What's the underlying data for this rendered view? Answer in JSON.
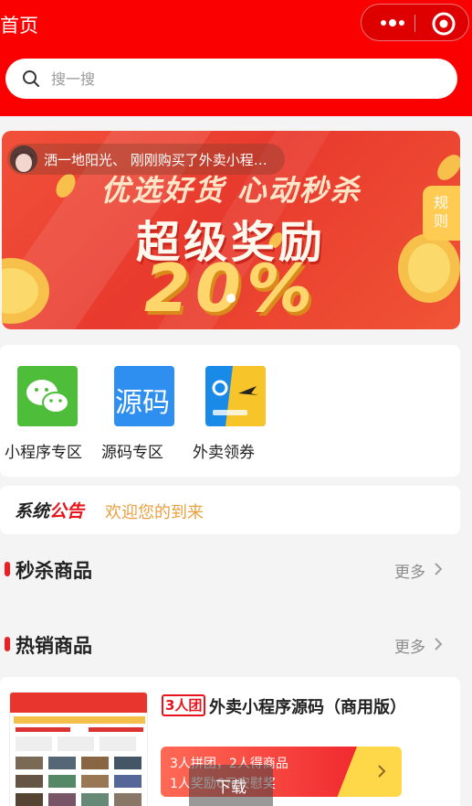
{
  "header": {
    "title": "首页",
    "search_placeholder": "搜一搜",
    "menu_icon": "more-dots-icon",
    "close_icon": "target-close-icon",
    "bg_color": "#fb0000"
  },
  "banner": {
    "notice": "洒一地阳光、 刚刚购买了外卖小程…",
    "line1": "优选好货 心动秒杀",
    "line2": "超级奖励",
    "line3": "20%",
    "rules_label": "规则"
  },
  "categories": [
    {
      "label": "小程序专区",
      "icon": "wechat-icon"
    },
    {
      "label": "源码专区",
      "icon": "source-code-icon",
      "icon_text": "源码"
    },
    {
      "label": "外卖领券",
      "icon": "takeout-coupon-icon"
    }
  ],
  "announcement": {
    "tag_prefix": "系统",
    "tag_suffix": "公告",
    "message": "欢迎您的到来"
  },
  "sections": {
    "flash_sale": {
      "title": "秒杀商品",
      "more": "更多"
    },
    "hot": {
      "title": "热销商品",
      "more": "更多"
    }
  },
  "product": {
    "badge": "3人团",
    "name": "外卖小程序源码（商用版）",
    "group_line1": "3人拼团，2人得商品",
    "group_line2": "1人奖励6元安慰奖",
    "download_label": "下载"
  },
  "colors": {
    "accent_red": "#e8141b",
    "notice_orange": "#e8a13f",
    "gold": "#ffd84a"
  }
}
